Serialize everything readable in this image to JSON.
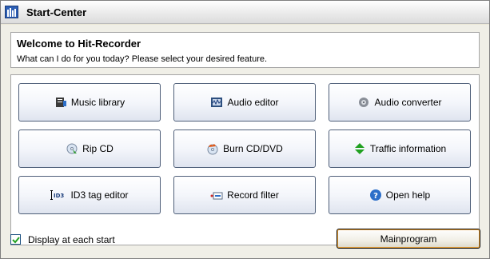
{
  "window": {
    "title": "Start-Center"
  },
  "welcome": {
    "title": "Welcome to Hit-Recorder",
    "subtitle": "What can I do for you today? Please select your desired feature."
  },
  "features": [
    {
      "label": "Music library",
      "icon": "music-library-icon"
    },
    {
      "label": "Audio editor",
      "icon": "audio-editor-icon"
    },
    {
      "label": "Audio converter",
      "icon": "audio-converter-icon"
    },
    {
      "label": "Rip CD",
      "icon": "rip-cd-icon"
    },
    {
      "label": "Burn CD/DVD",
      "icon": "burn-cd-icon"
    },
    {
      "label": "Traffic information",
      "icon": "traffic-info-icon"
    },
    {
      "label": "ID3 tag editor",
      "icon": "id3-tag-icon"
    },
    {
      "label": "Record filter",
      "icon": "record-filter-icon"
    },
    {
      "label": "Open help",
      "icon": "help-icon"
    }
  ],
  "footer": {
    "checkbox_label": "Display at each start",
    "checkbox_checked": true,
    "main_button": "Mainprogram"
  },
  "colors": {
    "window_bg": "#f0efe7",
    "button_border": "#4f5f79",
    "check_mark": "#21a121",
    "focus_border": "#e7a13b"
  }
}
